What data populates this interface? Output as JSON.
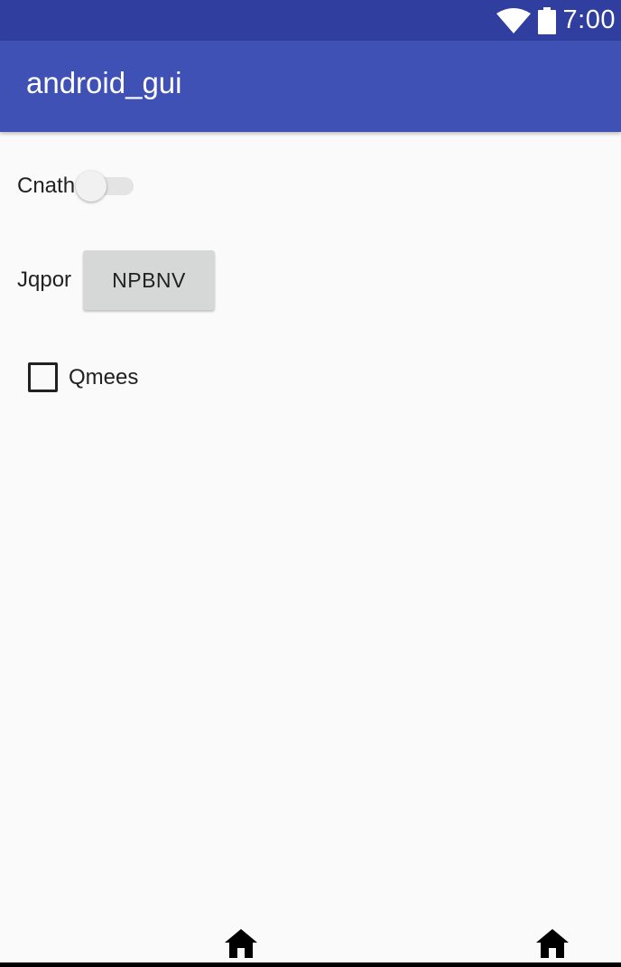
{
  "status_bar": {
    "time": "7:00",
    "icons": [
      "wifi-icon",
      "battery-icon"
    ],
    "background_color": "#303f9f"
  },
  "app_bar": {
    "title": "android_gui",
    "background_color": "#3f51b5"
  },
  "content": {
    "switch_row": {
      "label": "Cnath",
      "checked": false
    },
    "button_row": {
      "label": "Jqpor",
      "button_label": "NPBNV"
    },
    "checkbox_row": {
      "label": "Qmees",
      "checked": false
    }
  },
  "nav_bar": {
    "icons": [
      "home-icon",
      "home-icon"
    ]
  }
}
